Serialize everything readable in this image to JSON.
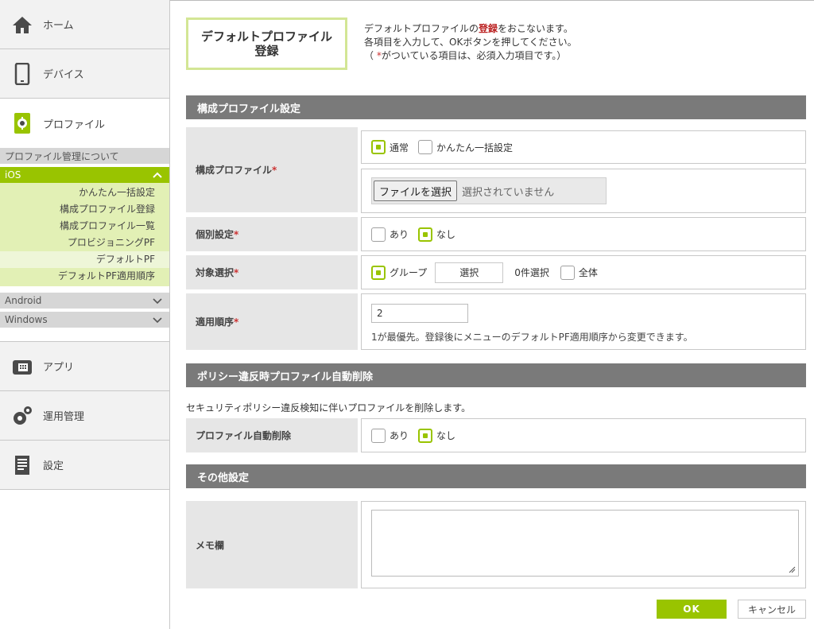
{
  "sidebar": {
    "home": "ホーム",
    "device": "デバイス",
    "profile": "プロファイル",
    "profile_about": "プロファイル管理について",
    "ios": "iOS",
    "ios_items": [
      "かんたん一括設定",
      "構成プロファイル登録",
      "構成プロファイル一覧",
      "プロビジョニングPF",
      "デフォルトPF",
      "デフォルトPF適用順序"
    ],
    "android": "Android",
    "windows": "Windows",
    "app": "アプリ",
    "operation": "運用管理",
    "settings": "設定"
  },
  "page": {
    "title_line1": "デフォルトプロファイル",
    "title_line2": "登録",
    "desc1_pre": "デフォルトプロファイルの",
    "desc1_em": "登録",
    "desc1_post": "をおこないます。",
    "desc2": "各項目を入力して、OKボタンを押してください。",
    "desc3_pre": "（ ",
    "desc3_star": "*",
    "desc3_post": "がついている項目は、必須入力項目です。）"
  },
  "section1": {
    "title": "構成プロファイル設定",
    "config_label": "構成プロファイル",
    "mode_normal": "通常",
    "mode_bulk": "かんたん一括設定",
    "file_button": "ファイルを選択",
    "file_none": "選択されていません",
    "individual_label": "個別設定",
    "yes": "あり",
    "no": "なし",
    "target_label": "対象選択",
    "group": "グループ",
    "select": "選択",
    "count": "0件選択",
    "all": "全体",
    "order_label": "適用順序",
    "order_value": "2",
    "order_note": "1が最優先。登録後にメニューのデフォルトPF適用順序から変更できます。",
    "required_mark": "*"
  },
  "section2": {
    "title": "ポリシー違反時プロファイル自動削除",
    "note": "セキュリティポリシー違反検知に伴いプロファイルを削除します。",
    "auto_delete_label": "プロファイル自動削除",
    "yes": "あり",
    "no": "なし"
  },
  "section3": {
    "title": "その他設定",
    "memo_label": "メモ欄"
  },
  "buttons": {
    "ok": "OK",
    "cancel": "キャンセル"
  },
  "colors": {
    "accent": "#99c400",
    "section_bar": "#7a7a7a",
    "required": "#cc3333"
  }
}
